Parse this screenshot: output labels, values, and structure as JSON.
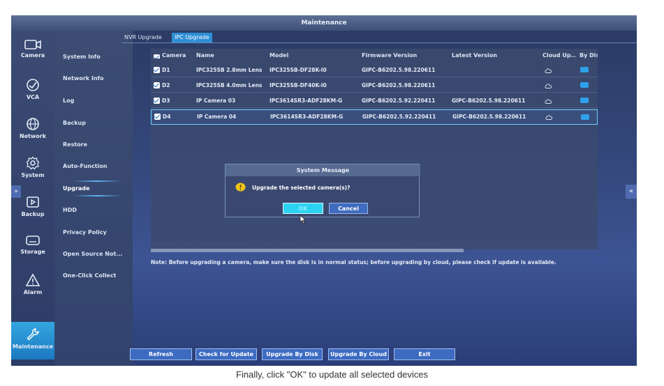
{
  "window": {
    "title": "Maintenance"
  },
  "nav": [
    {
      "label": "Camera",
      "icon": "camera-icon"
    },
    {
      "label": "VCA",
      "icon": "vca-icon"
    },
    {
      "label": "Network",
      "icon": "globe-icon"
    },
    {
      "label": "System",
      "icon": "gear-icon"
    },
    {
      "label": "Backup",
      "icon": "backup-icon"
    },
    {
      "label": "Storage",
      "icon": "storage-icon"
    },
    {
      "label": "Alarm",
      "icon": "alarm-icon"
    },
    {
      "label": "Maintenance",
      "icon": "wrench-icon"
    }
  ],
  "submenu": [
    "System Info",
    "Network Info",
    "Log",
    "Backup",
    "Restore",
    "Auto-Function",
    "Upgrade",
    "HDD",
    "Privacy Policy",
    "Open Source Not...",
    "One-Click Collect"
  ],
  "tabs": [
    "NVR Upgrade",
    "IPC Upgrade"
  ],
  "table": {
    "headers": [
      "Camera",
      "Name",
      "Model",
      "Firmware Version",
      "Latest Version",
      "Cloud Up...",
      "By Dis"
    ],
    "rows": [
      {
        "camera": "D1",
        "name": "IPC325SB 2.8mm Lens",
        "model": "IPC325SB-DF28K-I0",
        "firmware": "GIPC-B6202.5.98.220611",
        "latest": ""
      },
      {
        "camera": "D2",
        "name": "IPC325SB 4.0mm Lens",
        "model": "IPC325SB-DF40K-I0",
        "firmware": "GIPC-B6202.5.98.220611",
        "latest": ""
      },
      {
        "camera": "D3",
        "name": "IP Camera 03",
        "model": "IPC3614SR3-ADF28KM-G",
        "firmware": "GIPC-B6202.5.92.220411",
        "latest": "GIPC-B6202.5.98.220611"
      },
      {
        "camera": "D4",
        "name": "IP Camera 04",
        "model": "IPC3614SR3-ADF28KM-G",
        "firmware": "GIPC-B6202.5.92.220411",
        "latest": "GIPC-B6202.5.98.220611"
      }
    ]
  },
  "note": "Note: Before upgrading a camera, make sure the disk is in normal status; before upgrading by cloud, please check if update is available.",
  "dialog": {
    "title": "System Message",
    "message": "Upgrade the selected camera(s)?",
    "ok_label": "OK",
    "cancel_label": "Cancel"
  },
  "buttons": {
    "refresh": "Refresh",
    "check_update": "Check for Update",
    "upgrade_disk": "Upgrade By Disk",
    "upgrade_cloud": "Upgrade By Cloud",
    "exit": "Exit"
  },
  "caption": "Finally, click \"OK\" to update all selected devices",
  "colors": {
    "accent": "#2e8fd6",
    "active_nav": "#1c79c1",
    "ok_button": "#2bd3f0"
  }
}
